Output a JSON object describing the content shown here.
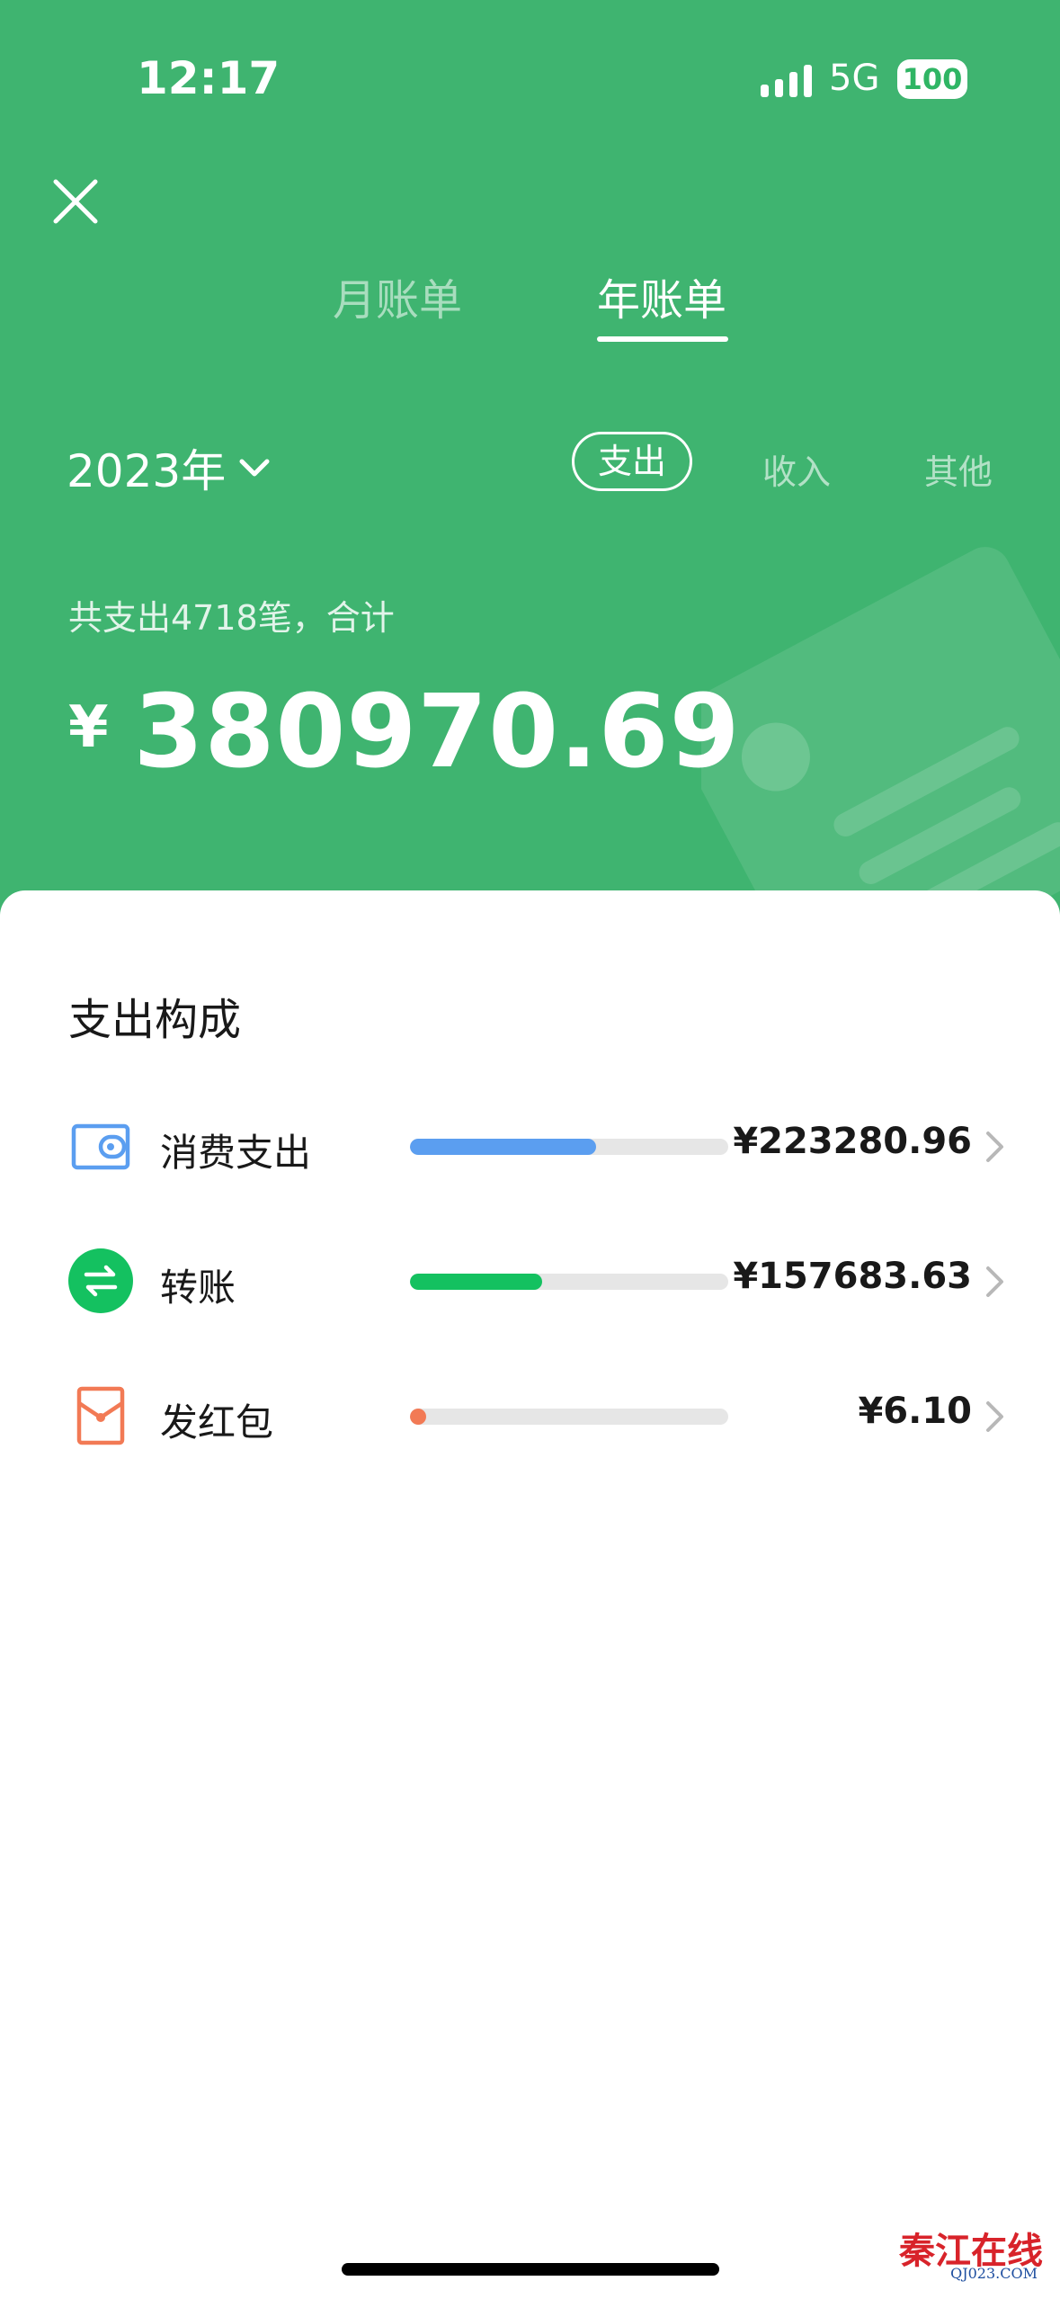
{
  "status_bar": {
    "time": "12:17",
    "network": "5G",
    "battery": "100"
  },
  "tabs": [
    {
      "label": "月账单",
      "active": false
    },
    {
      "label": "年账单",
      "active": true
    }
  ],
  "filter": {
    "year": "2023年",
    "types": [
      {
        "label": "支出",
        "selected": true
      },
      {
        "label": "收入",
        "selected": false
      },
      {
        "label": "其他",
        "selected": false
      }
    ]
  },
  "summary": {
    "text": "共支出4718笔，合计",
    "currency": "¥",
    "total": "380970.69"
  },
  "breakdown": {
    "title": "支出构成",
    "items": [
      {
        "label": "消费支出",
        "amount": "¥223280.96",
        "share": 0.586,
        "color": "#5b9ef0",
        "icon": "wallet-icon"
      },
      {
        "label": "转账",
        "amount": "¥157683.63",
        "share": 0.414,
        "color": "#14c160",
        "icon": "transfer-icon"
      },
      {
        "label": "发红包",
        "amount": "¥6.10",
        "share": 2e-05,
        "color": "#f27a55",
        "icon": "red-packet-icon"
      }
    ]
  },
  "watermark": {
    "main": "秦江在线",
    "sub": "QJ023.COM"
  },
  "colors": {
    "header": "#3fb470",
    "text": "#191919"
  }
}
